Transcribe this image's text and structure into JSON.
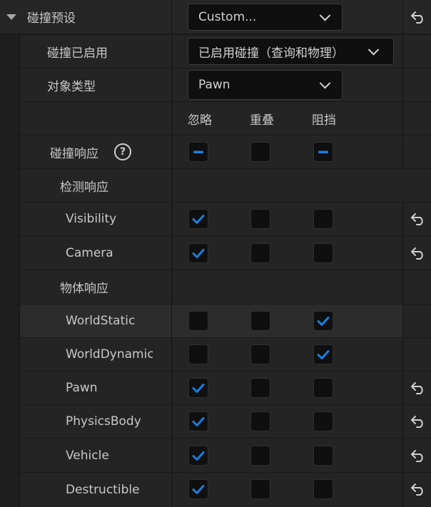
{
  "header": {
    "title": "碰撞预设",
    "preset_value": "Custom..."
  },
  "collision_enabled": {
    "label": "碰撞已启用",
    "value": "已启用碰撞（查询和物理）"
  },
  "object_type": {
    "label": "对象类型",
    "value": "Pawn"
  },
  "columns": [
    "忽略",
    "重叠",
    "阻挡"
  ],
  "collision_response": {
    "label": "碰撞响应",
    "help_glyph": "?",
    "states": [
      "mixed",
      "unchecked",
      "mixed"
    ]
  },
  "trace_section": {
    "label": "检测响应"
  },
  "trace_rows": [
    {
      "label": "Visibility",
      "states": [
        "checked",
        "unchecked",
        "unchecked"
      ],
      "reset": true
    },
    {
      "label": "Camera",
      "states": [
        "checked",
        "unchecked",
        "unchecked"
      ],
      "reset": true
    }
  ],
  "object_section": {
    "label": "物体响应"
  },
  "object_rows": [
    {
      "label": "WorldStatic",
      "states": [
        "unchecked",
        "unchecked",
        "checked"
      ],
      "reset": false
    },
    {
      "label": "WorldDynamic",
      "states": [
        "unchecked",
        "unchecked",
        "checked"
      ],
      "reset": false
    },
    {
      "label": "Pawn",
      "states": [
        "checked",
        "unchecked",
        "unchecked"
      ],
      "reset": true
    },
    {
      "label": "PhysicsBody",
      "states": [
        "checked",
        "unchecked",
        "unchecked"
      ],
      "reset": true
    },
    {
      "label": "Vehicle",
      "states": [
        "checked",
        "unchecked",
        "unchecked"
      ],
      "reset": true
    },
    {
      "label": "Destructible",
      "states": [
        "checked",
        "unchecked",
        "unchecked"
      ],
      "reset": true
    }
  ],
  "colors": {
    "accent": "#1a7fe0",
    "panel": "#242424",
    "field": "#0f0f0f"
  }
}
